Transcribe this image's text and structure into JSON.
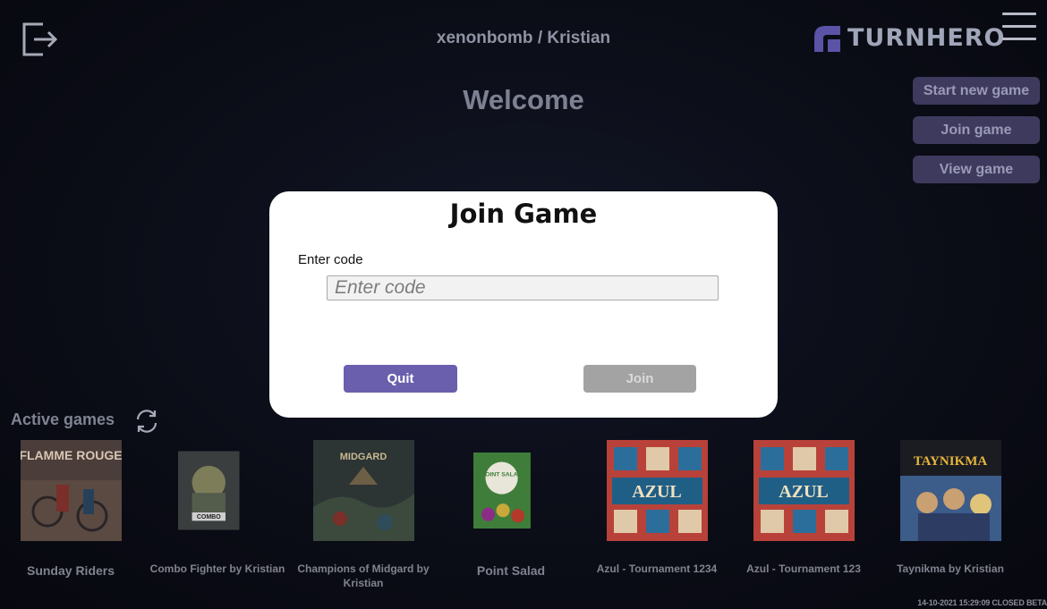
{
  "header": {
    "user_label": "xenonbomb / Kristian",
    "brand_name": "TURNHERO",
    "logout_icon": "logout-icon",
    "menu_icon": "hamburger-menu-icon"
  },
  "main": {
    "welcome": "Welcome",
    "actions": [
      {
        "label": "Start new game"
      },
      {
        "label": "Join game"
      },
      {
        "label": "View game"
      }
    ],
    "active_games_title": "Active games",
    "refresh_icon": "refresh-icon",
    "games": [
      {
        "name": "Sunday Riders",
        "art_text": "FLAMME ROUGE"
      },
      {
        "name": "Combo Fighter by Kristian",
        "art_text": "COMBO"
      },
      {
        "name": "Champions of Midgard by Kristian",
        "art_text": "MIDGARD"
      },
      {
        "name": "Point Salad",
        "art_text": "POINT SALAD"
      },
      {
        "name": "Azul - Tournament 1234",
        "art_text": "AZUL"
      },
      {
        "name": "Azul - Tournament 123",
        "art_text": "AZUL"
      },
      {
        "name": "Taynikma by Kristian",
        "art_text": "TAYNIKMA"
      }
    ],
    "status_footer": "14-10-2021 15:29:09 CLOSED BETA"
  },
  "modal": {
    "title": "Join Game",
    "code_label": "Enter code",
    "code_value": "",
    "code_placeholder": "Enter code",
    "quit_label": "Quit",
    "join_label": "Join"
  },
  "colors": {
    "accent": "#6a5fad",
    "side_button_bg": "#3e3a5e",
    "disabled_button_bg": "#a3a3a3",
    "background": "#0b0d17"
  }
}
